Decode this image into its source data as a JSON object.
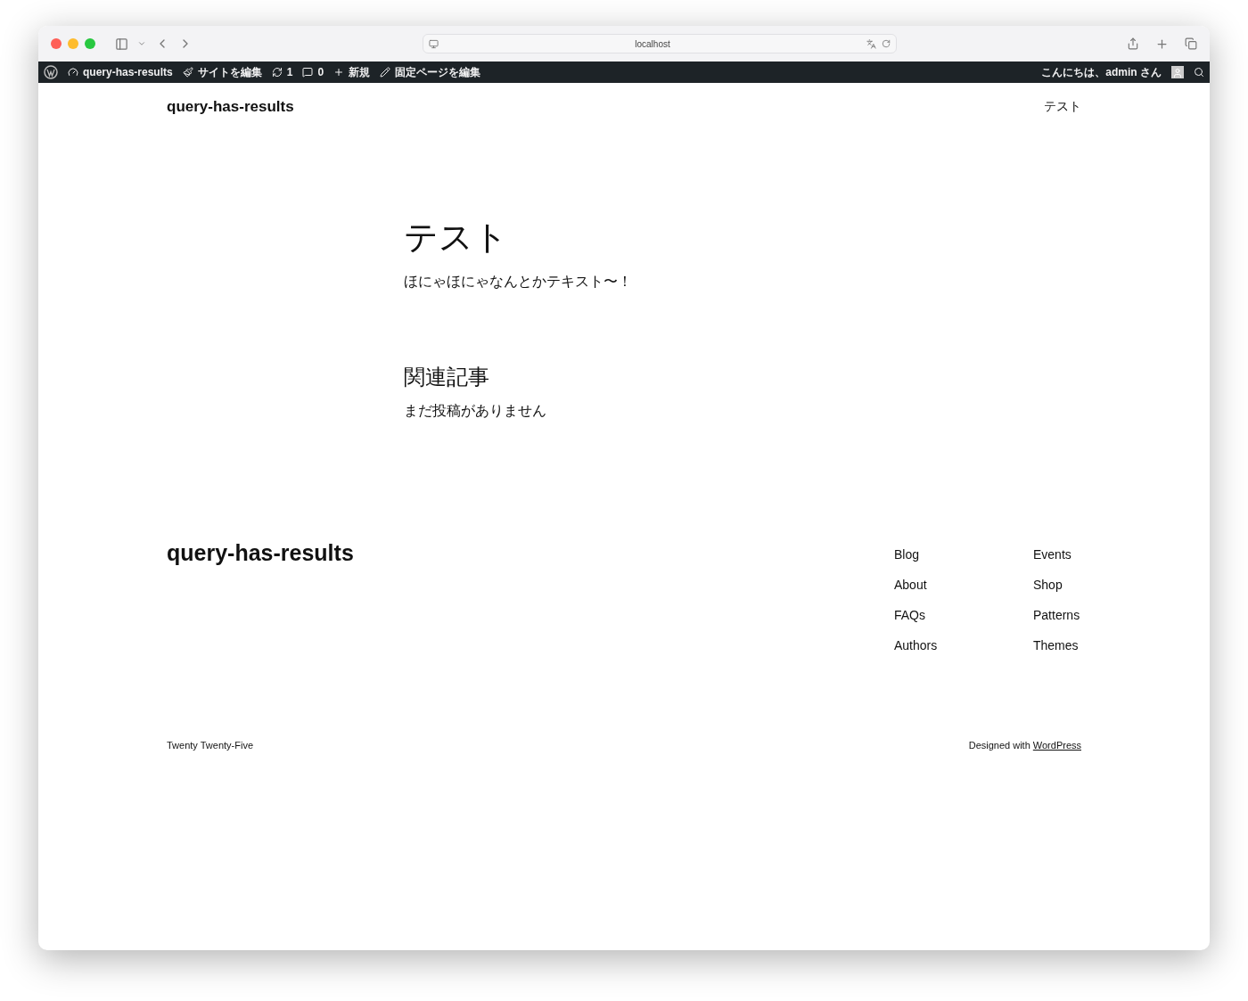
{
  "browser": {
    "url": "localhost"
  },
  "admin_bar": {
    "items": [
      {
        "kind": "site",
        "label": "query-has-results"
      },
      {
        "kind": "edit-site",
        "label": "サイトを編集"
      },
      {
        "kind": "updates",
        "label": "1"
      },
      {
        "kind": "comments",
        "label": "0"
      },
      {
        "kind": "new",
        "label": "新規"
      },
      {
        "kind": "edit-page",
        "label": "固定ページを編集"
      }
    ],
    "greeting": "こんにちは、admin さん"
  },
  "header": {
    "site_title": "query-has-results",
    "nav": [
      "テスト"
    ]
  },
  "post": {
    "title": "テスト",
    "body": "ほにゃほにゃなんとかテキスト〜！"
  },
  "related": {
    "heading": "関連記事",
    "empty_message": "まだ投稿がありません"
  },
  "footer": {
    "site_title": "query-has-results",
    "columns": [
      [
        "Blog",
        "About",
        "FAQs",
        "Authors"
      ],
      [
        "Events",
        "Shop",
        "Patterns",
        "Themes"
      ]
    ],
    "theme_credit": "Twenty Twenty-Five",
    "designed_prefix": "Designed with",
    "designed_link": "WordPress"
  }
}
